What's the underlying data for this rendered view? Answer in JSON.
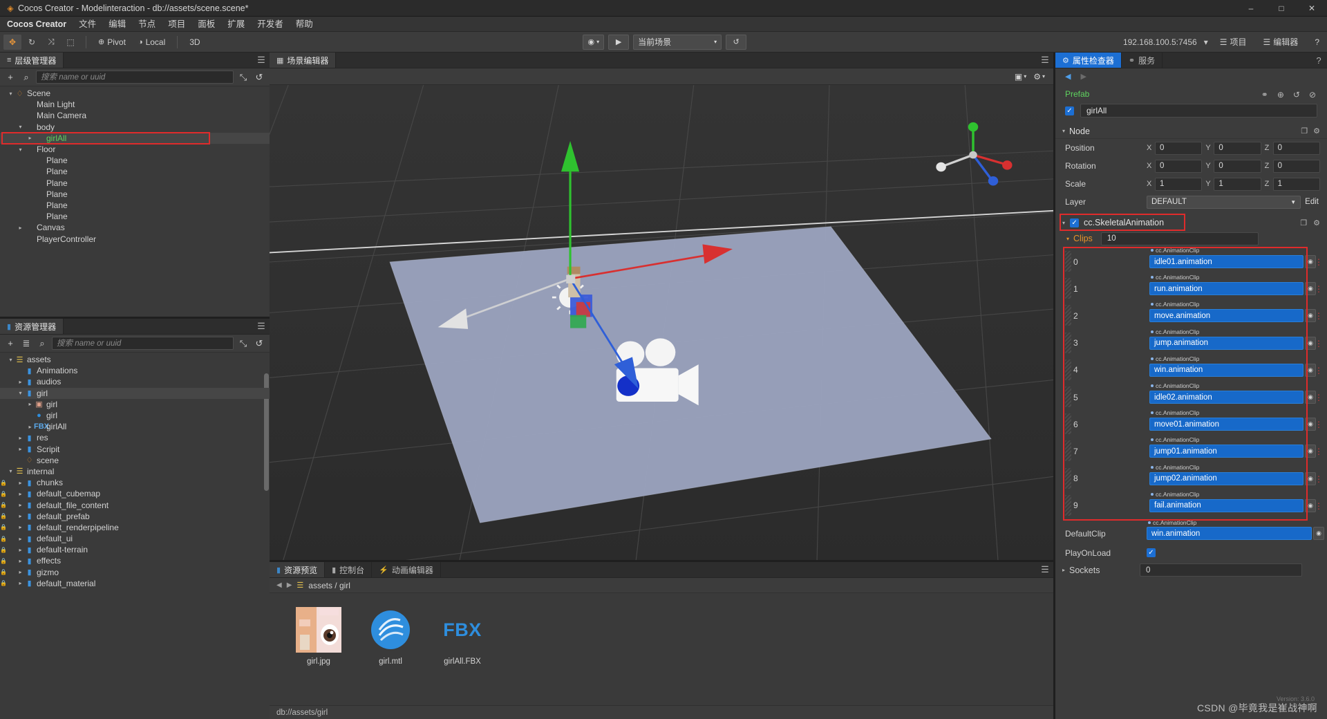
{
  "window": {
    "title": "Cocos Creator - Modelinteraction - db://assets/scene.scene*",
    "app_icon": "cocos-logo-icon",
    "minimize": "–",
    "maximize": "□",
    "close": "✕"
  },
  "menu": {
    "items": [
      {
        "label": "Cocos Creator"
      },
      {
        "label": "文件"
      },
      {
        "label": "编辑"
      },
      {
        "label": "节点"
      },
      {
        "label": "项目"
      },
      {
        "label": "面板"
      },
      {
        "label": "扩展"
      },
      {
        "label": "开发者"
      },
      {
        "label": "帮助"
      }
    ]
  },
  "toolbar": {
    "transform_tools": [
      {
        "name": "move-tool",
        "glyph": "✥",
        "active": true
      },
      {
        "name": "rotate-tool",
        "glyph": "↻",
        "active": false
      },
      {
        "name": "scale-tool",
        "glyph": "⤨",
        "active": false
      },
      {
        "name": "rect-tool",
        "glyph": "⬚",
        "active": false
      }
    ],
    "pivot_label": "Pivot",
    "pivot_icon": "⊕",
    "coord_label": "Local",
    "coord_icon": "◑",
    "dimension_label": "3D",
    "preview_device_icon": "◉",
    "play_icon": "▶",
    "scene_select_value": "当前场景",
    "refresh_icon": "↺",
    "ip_address": "192.168.100.5:7456",
    "wifi_icon": "▾",
    "project_label": "项目",
    "project_icon": "☰",
    "editor_label": "编辑器",
    "editor_icon": "☰",
    "help_icon": "?"
  },
  "hierarchy": {
    "tab_label": "层级管理器",
    "tab_icon": "hierarchy-icon",
    "add_icon": "+",
    "search_icon": "⌕",
    "search_placeholder": "搜索 name or uuid",
    "search_value": "",
    "expand_icon": "⤡",
    "sync_icon": "↺",
    "menu_icon": "☰",
    "nodes": [
      {
        "label": "Scene",
        "depth": 0,
        "arrow": "down",
        "icon": "scene",
        "selected": false,
        "highlight": false
      },
      {
        "label": "Main Light",
        "depth": 1,
        "arrow": "none",
        "icon": "none",
        "selected": false,
        "highlight": false
      },
      {
        "label": "Main Camera",
        "depth": 1,
        "arrow": "none",
        "icon": "none",
        "selected": false,
        "highlight": false
      },
      {
        "label": "body",
        "depth": 1,
        "arrow": "down",
        "icon": "none",
        "selected": false,
        "highlight": false
      },
      {
        "label": "girlAll",
        "depth": 2,
        "arrow": "right",
        "icon": "none",
        "selected": true,
        "highlight": true,
        "green": true
      },
      {
        "label": "Floor",
        "depth": 1,
        "arrow": "down",
        "icon": "none",
        "selected": false,
        "highlight": false
      },
      {
        "label": "Plane",
        "depth": 2,
        "arrow": "none",
        "icon": "none",
        "selected": false,
        "highlight": false
      },
      {
        "label": "Plane",
        "depth": 2,
        "arrow": "none",
        "icon": "none",
        "selected": false,
        "highlight": false
      },
      {
        "label": "Plane",
        "depth": 2,
        "arrow": "none",
        "icon": "none",
        "selected": false,
        "highlight": false
      },
      {
        "label": "Plane",
        "depth": 2,
        "arrow": "none",
        "icon": "none",
        "selected": false,
        "highlight": false
      },
      {
        "label": "Plane",
        "depth": 2,
        "arrow": "none",
        "icon": "none",
        "selected": false,
        "highlight": false
      },
      {
        "label": "Plane",
        "depth": 2,
        "arrow": "none",
        "icon": "none",
        "selected": false,
        "highlight": false
      },
      {
        "label": "Canvas",
        "depth": 1,
        "arrow": "right",
        "icon": "none",
        "selected": false,
        "highlight": false
      },
      {
        "label": "PlayerController",
        "depth": 1,
        "arrow": "none",
        "icon": "none",
        "selected": false,
        "highlight": false
      }
    ]
  },
  "assets": {
    "tab_label": "资源管理器",
    "tab_icon": "folder-icon",
    "add_icon": "+",
    "sort_icon": "≣",
    "search_icon": "⌕",
    "search_placeholder": "搜索 name or uuid",
    "search_value": "",
    "expand_icon": "⤡",
    "sync_icon": "↺",
    "menu_icon": "☰",
    "nodes": [
      {
        "label": "assets",
        "depth": 0,
        "arrow": "down",
        "icon": "db",
        "selected": false
      },
      {
        "label": "Animations",
        "depth": 1,
        "arrow": "none",
        "icon": "folder",
        "selected": false
      },
      {
        "label": "audios",
        "depth": 1,
        "arrow": "right",
        "icon": "folder",
        "selected": false
      },
      {
        "label": "girl",
        "depth": 1,
        "arrow": "down",
        "icon": "folder",
        "selected": true
      },
      {
        "label": "girl",
        "depth": 2,
        "arrow": "right",
        "icon": "image",
        "selected": false
      },
      {
        "label": "girl",
        "depth": 2,
        "arrow": "none",
        "icon": "mtl",
        "selected": false
      },
      {
        "label": "girlAll",
        "depth": 2,
        "arrow": "right",
        "icon": "fbx",
        "selected": false
      },
      {
        "label": "res",
        "depth": 1,
        "arrow": "right",
        "icon": "folder",
        "selected": false
      },
      {
        "label": "Scripit",
        "depth": 1,
        "arrow": "right",
        "icon": "folder",
        "selected": false
      },
      {
        "label": "scene",
        "depth": 1,
        "arrow": "none",
        "icon": "scene",
        "selected": false
      },
      {
        "label": "internal",
        "depth": 0,
        "arrow": "down",
        "icon": "db",
        "selected": false
      },
      {
        "label": "chunks",
        "depth": 1,
        "arrow": "right",
        "icon": "folder",
        "selected": false,
        "lock": true
      },
      {
        "label": "default_cubemap",
        "depth": 1,
        "arrow": "right",
        "icon": "folder",
        "selected": false,
        "lock": true
      },
      {
        "label": "default_file_content",
        "depth": 1,
        "arrow": "right",
        "icon": "folder",
        "selected": false,
        "lock": true
      },
      {
        "label": "default_prefab",
        "depth": 1,
        "arrow": "right",
        "icon": "folder",
        "selected": false,
        "lock": true
      },
      {
        "label": "default_renderpipeline",
        "depth": 1,
        "arrow": "right",
        "icon": "folder",
        "selected": false,
        "lock": true
      },
      {
        "label": "default_ui",
        "depth": 1,
        "arrow": "right",
        "icon": "folder",
        "selected": false,
        "lock": true
      },
      {
        "label": "default-terrain",
        "depth": 1,
        "arrow": "right",
        "icon": "folder",
        "selected": false,
        "lock": true
      },
      {
        "label": "effects",
        "depth": 1,
        "arrow": "right",
        "icon": "folder",
        "selected": false,
        "lock": true
      },
      {
        "label": "gizmo",
        "depth": 1,
        "arrow": "right",
        "icon": "folder",
        "selected": false,
        "lock": true
      },
      {
        "label": "default_material",
        "depth": 1,
        "arrow": "right",
        "icon": "folder",
        "selected": false,
        "lock": true
      }
    ]
  },
  "scene": {
    "tab_label": "场景编辑器",
    "tab_icon": "scene-editor-icon",
    "menu_icon": "☰",
    "camera_icon": "▣",
    "gear_icon": "⚙",
    "gizmo_axes": [
      "x",
      "y",
      "z"
    ]
  },
  "bottom": {
    "tabs": [
      {
        "label": "资源预览",
        "icon": "folder-icon",
        "active": true
      },
      {
        "label": "控制台",
        "icon": "console-icon",
        "active": false
      },
      {
        "label": "动画编辑器",
        "icon": "animation-icon",
        "active": false
      }
    ],
    "menu_icon": "☰",
    "breadcrumb": "assets / girl",
    "breadcrumb_icon": "db-icon",
    "back_icon": "◀",
    "forward_icon": "▶",
    "items": [
      {
        "label": "girl.jpg",
        "kind": "image"
      },
      {
        "label": "girl.mtl",
        "kind": "material"
      },
      {
        "label": "girlAll.FBX",
        "kind": "fbx"
      }
    ],
    "status": "db://assets/girl"
  },
  "inspector": {
    "tabs": [
      {
        "label": "属性检查器",
        "icon": "gear-icon",
        "active": true
      },
      {
        "label": "服务",
        "icon": "link-icon",
        "active": false
      }
    ],
    "help_icon": "?",
    "nav_back": "◀",
    "nav_forward": "▶",
    "prefab_label": "Prefab",
    "prefab_tools": [
      "⚭",
      "⊕",
      "↺",
      "⊘"
    ],
    "node_enabled": true,
    "node_name": "girlAll",
    "node_section": {
      "title": "Node",
      "caret": "▾",
      "tools": [
        "❐",
        "⚙"
      ],
      "position": {
        "label": "Position",
        "x": "0",
        "y": "0",
        "z": "0"
      },
      "rotation": {
        "label": "Rotation",
        "x": "0",
        "y": "0",
        "z": "0"
      },
      "scale": {
        "label": "Scale",
        "x": "1",
        "y": "1",
        "z": "1"
      },
      "layer": {
        "label": "Layer",
        "value": "DEFAULT",
        "edit_label": "Edit",
        "dropdown_icon": "▼"
      }
    },
    "component": {
      "title": "cc.SkeletalAnimation",
      "enabled": true,
      "caret": "▾",
      "tools": [
        "❐",
        "⚙"
      ],
      "clips_label": "Clips",
      "clips_caret": "▾",
      "clips_count": "10",
      "clip_type_label": "cc.AnimationClip",
      "clips": [
        {
          "index": "0",
          "value": "idle01.animation"
        },
        {
          "index": "1",
          "value": "run.animation"
        },
        {
          "index": "2",
          "value": "move.animation"
        },
        {
          "index": "3",
          "value": "jump.animation"
        },
        {
          "index": "4",
          "value": "win.animation"
        },
        {
          "index": "5",
          "value": "idle02.animation"
        },
        {
          "index": "6",
          "value": "move01.animation"
        },
        {
          "index": "7",
          "value": "jump01.animation"
        },
        {
          "index": "8",
          "value": "jump02.animation"
        },
        {
          "index": "9",
          "value": "fail.animation"
        }
      ],
      "default_clip": {
        "label": "DefaultClip",
        "type_label": "cc.AnimationClip",
        "value": "win.animation"
      },
      "play_on_load": {
        "label": "PlayOnLoad",
        "checked": true
      },
      "sockets": {
        "label": "Sockets",
        "caret": "▸",
        "value": "0"
      }
    }
  },
  "watermark": {
    "text": "CSDN @毕竟我是崔战神啊",
    "version": "Version: 3.6.0"
  },
  "colors": {
    "accent_blue": "#1c6fd4",
    "clip_blue": "#1769c9",
    "highlight_red": "#e02b2b",
    "orange": "#e8932a",
    "green": "#5fd35f"
  }
}
